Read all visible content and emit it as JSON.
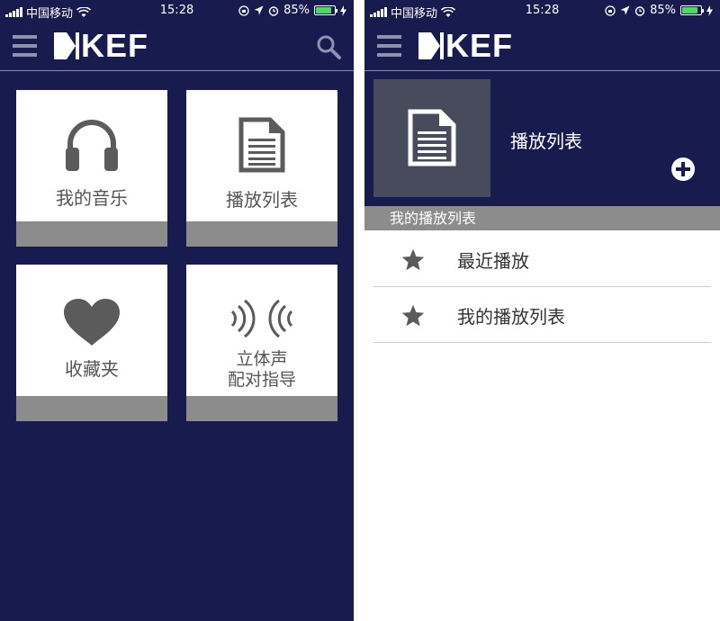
{
  "status": {
    "carrier": "中国移动",
    "time": "15:28",
    "battery": "85%",
    "battery_level": 0.85
  },
  "brand": {
    "logo_text": "KEF"
  },
  "left_screen": {
    "tiles": [
      {
        "label": "我的音乐",
        "icon": "headphones-icon"
      },
      {
        "label": "播放列表",
        "icon": "document-icon"
      },
      {
        "label": "收藏夹",
        "icon": "heart-icon"
      },
      {
        "label_line1": "立体声",
        "label_line2": "配对指导",
        "icon": "stereo-waves-icon"
      }
    ]
  },
  "right_screen": {
    "header_title": "播放列表",
    "section_title": "我的播放列表",
    "rows": [
      {
        "label": "最近播放",
        "icon": "star-icon"
      },
      {
        "label": "我的播放列表",
        "icon": "star-icon"
      }
    ]
  },
  "colors": {
    "navy": "#181b4e",
    "gray_bar": "#8c8c8c",
    "icon_gray": "#5b5b5b",
    "battery_green": "#4cd964"
  }
}
